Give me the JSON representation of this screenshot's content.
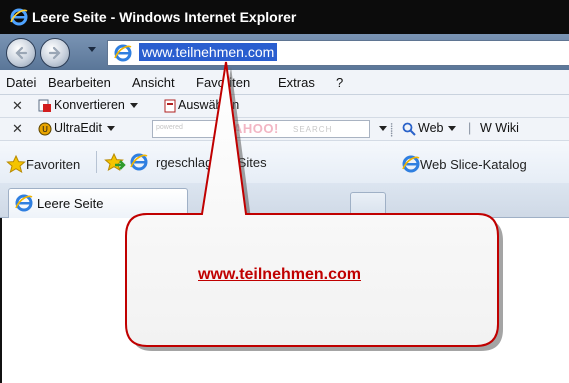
{
  "window": {
    "title": "Leere Seite - Windows Internet Explorer"
  },
  "address_bar": {
    "url": "www.teilnehmen.com"
  },
  "menu": {
    "items": [
      "Datei",
      "Bearbeiten",
      "Ansicht",
      "Favoriten",
      "Extras",
      "?"
    ]
  },
  "toolbar1": {
    "convert_label": "Konvertieren",
    "select_label": "Auswählen"
  },
  "toolbar2": {
    "ultraedit_label": "UltraEdit",
    "search_powered": "powered",
    "search_brand": "YAHOO!",
    "search_word": "SEARCH",
    "web_label": "Web",
    "wiki_label": "W Wiki"
  },
  "favorites_bar": {
    "favorites_label": "Favoriten",
    "suggested_label": "rgeschlagene Sites",
    "webslice_label": "Web Slice-Katalog"
  },
  "tabs": {
    "active_label": "Leere Seite"
  },
  "callout": {
    "text": "www.teilnehmen.com"
  },
  "colors": {
    "titlebar": "#0c0c0c",
    "url_highlight": "#2a5ecf",
    "callout_text": "#c00000"
  }
}
